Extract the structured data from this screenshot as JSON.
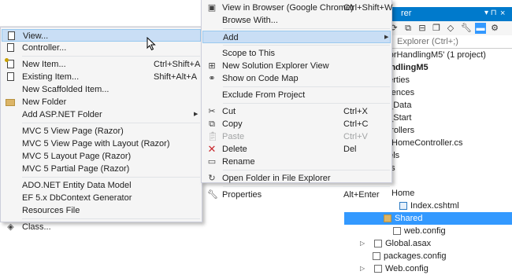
{
  "solution_explorer": {
    "title": "rer",
    "pin_glyph": "▾ ⊓",
    "close_glyph": "×",
    "search_placeholder": "Explorer (Ctrl+;)",
    "tree": [
      {
        "label": "7ErrorHandlingM5' (1 project)",
        "bold": false,
        "selected": false,
        "icon": "none",
        "expander": ""
      },
      {
        "label": "rHandlingM5",
        "bold": true,
        "selected": false,
        "icon": "none",
        "expander": ""
      },
      {
        "label": "perties",
        "bold": false,
        "selected": false,
        "icon": "none",
        "expander": ""
      },
      {
        "label": "erences",
        "bold": false,
        "selected": false,
        "icon": "none",
        "expander": ""
      },
      {
        "label": "p_Data",
        "bold": false,
        "selected": false,
        "icon": "none",
        "expander": ""
      },
      {
        "label": "p_Start",
        "bold": false,
        "selected": false,
        "icon": "none",
        "expander": ""
      },
      {
        "label": "ntrollers",
        "bold": false,
        "selected": false,
        "icon": "none",
        "expander": ""
      },
      {
        "label": "HomeController.cs",
        "bold": false,
        "selected": false,
        "icon": "none",
        "expander": ""
      },
      {
        "label": "dels",
        "bold": false,
        "selected": false,
        "icon": "none",
        "expander": ""
      },
      {
        "label": "pts",
        "bold": false,
        "selected": false,
        "icon": "none",
        "expander": ""
      },
      {
        "label": "vs",
        "bold": false,
        "selected": false,
        "icon": "none",
        "expander": ""
      },
      {
        "label": "Home",
        "bold": false,
        "selected": false,
        "icon": "none",
        "expander": ""
      },
      {
        "label": "Index.cshtml",
        "bold": false,
        "selected": false,
        "icon": "cshtml",
        "expander": ""
      },
      {
        "label": "Shared",
        "bold": false,
        "selected": true,
        "icon": "folder",
        "expander": ""
      },
      {
        "label": "web.config",
        "bold": false,
        "selected": false,
        "icon": "file",
        "expander": ""
      },
      {
        "label": "Global.asax",
        "bold": false,
        "selected": false,
        "icon": "file",
        "expander": "▷"
      },
      {
        "label": "packages.config",
        "bold": false,
        "selected": false,
        "icon": "file",
        "expander": ""
      },
      {
        "label": "Web.config",
        "bold": false,
        "selected": false,
        "icon": "file",
        "expander": "▷"
      }
    ]
  },
  "submenu": {
    "items": [
      {
        "label": "View...",
        "icon": "page-icon"
      },
      {
        "label": "Controller...",
        "icon": "controller-icon"
      },
      {
        "sep": true
      },
      {
        "label": "New Item...",
        "shortcut": "Ctrl+Shift+A",
        "icon": "new-item-icon"
      },
      {
        "label": "Existing Item...",
        "shortcut": "Shift+Alt+A",
        "icon": "existing-item-icon"
      },
      {
        "label": "New Scaffolded Item...",
        "icon": ""
      },
      {
        "label": "New Folder",
        "icon": "folder-icon"
      },
      {
        "label": "Add ASP.NET Folder",
        "arrow": true,
        "icon": ""
      },
      {
        "sep": true
      },
      {
        "label": "MVC 5 View Page (Razor)",
        "icon": ""
      },
      {
        "label": "MVC 5 View Page with Layout (Razor)",
        "icon": ""
      },
      {
        "label": "MVC 5 Layout Page (Razor)",
        "icon": ""
      },
      {
        "label": "MVC 5 Partial Page (Razor)",
        "icon": ""
      },
      {
        "sep": true
      },
      {
        "label": "ADO.NET Entity Data Model",
        "icon": ""
      },
      {
        "label": "EF 5.x DbContext Generator",
        "icon": ""
      },
      {
        "label": "Resources File",
        "icon": ""
      },
      {
        "sep": true
      },
      {
        "label": "Class...",
        "icon": "class-icon"
      }
    ]
  },
  "context_menu": {
    "items": [
      {
        "label": "View in Browser (Google Chrome)",
        "shortcut": "Ctrl+Shift+W",
        "icon": "browser-icon"
      },
      {
        "label": "Browse With...",
        "icon": ""
      },
      {
        "sep": true
      },
      {
        "label": "Add",
        "arrow": true,
        "icon": ""
      },
      {
        "sep": true
      },
      {
        "label": "Scope to This",
        "icon": ""
      },
      {
        "label": "New Solution Explorer View",
        "icon": "new-view-icon"
      },
      {
        "label": "Show on Code Map",
        "icon": "code-map-icon"
      },
      {
        "sep": true
      },
      {
        "label": "Exclude From Project",
        "icon": ""
      },
      {
        "sep": true
      },
      {
        "label": "Cut",
        "shortcut": "Ctrl+X",
        "icon": "scissors-icon"
      },
      {
        "label": "Copy",
        "shortcut": "Ctrl+C",
        "icon": "copy-icon"
      },
      {
        "label": "Paste",
        "shortcut": "Ctrl+V",
        "icon": "paste-icon",
        "disabled": true
      },
      {
        "label": "Delete",
        "shortcut": "Del",
        "icon": "delete-icon"
      },
      {
        "label": "Rename",
        "icon": "rename-icon"
      },
      {
        "sep": true
      },
      {
        "label": "Open Folder in File Explorer",
        "icon": "open-folder-icon"
      },
      {
        "sep": true
      },
      {
        "label": "Properties",
        "shortcut": "Alt+Enter",
        "icon": "wrench-icon"
      }
    ]
  }
}
